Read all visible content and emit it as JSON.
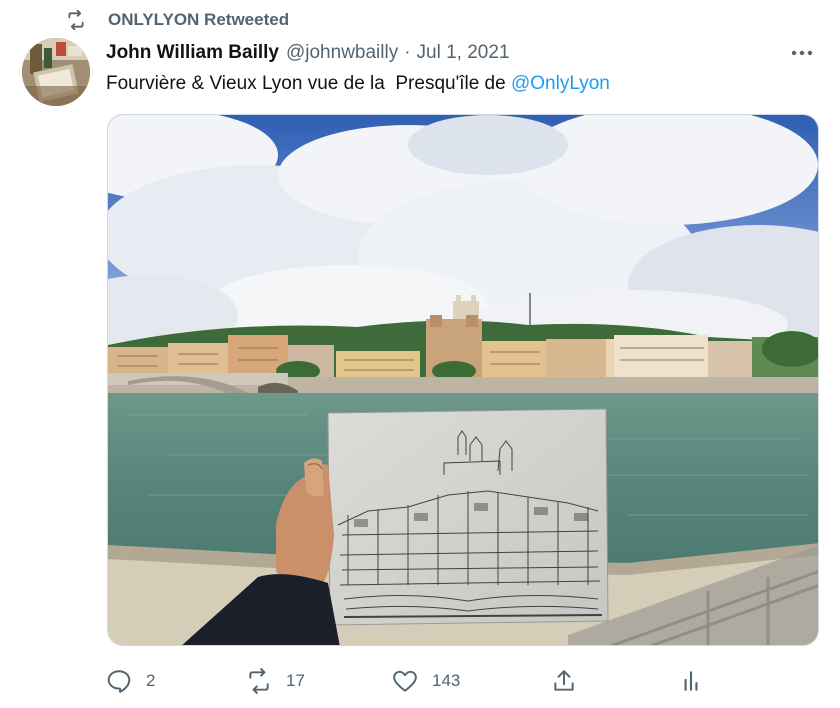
{
  "context": {
    "retweeted_by": "ONLYLYON Retweeted"
  },
  "author": {
    "name": "John William Bailly",
    "handle": "@johnwbailly",
    "separator": "·",
    "date": "Jul 1, 2021"
  },
  "tweet": {
    "text_before": "Fourvière & Vieux Lyon vue de la  Presqu'île de ",
    "mention": "@OnlyLyon"
  },
  "actions": {
    "reply_count": "2",
    "retweet_count": "17",
    "like_count": "143"
  },
  "colors": {
    "link": "#1d9bf0",
    "secondary_text": "#536471",
    "primary_text": "#0f1419"
  },
  "icons": {
    "retweet_context": "retweet-icon",
    "more": "more-icon",
    "reply": "reply-icon",
    "retweet": "retweet-icon",
    "like": "heart-icon",
    "share": "share-icon",
    "analytics": "analytics-icon"
  }
}
